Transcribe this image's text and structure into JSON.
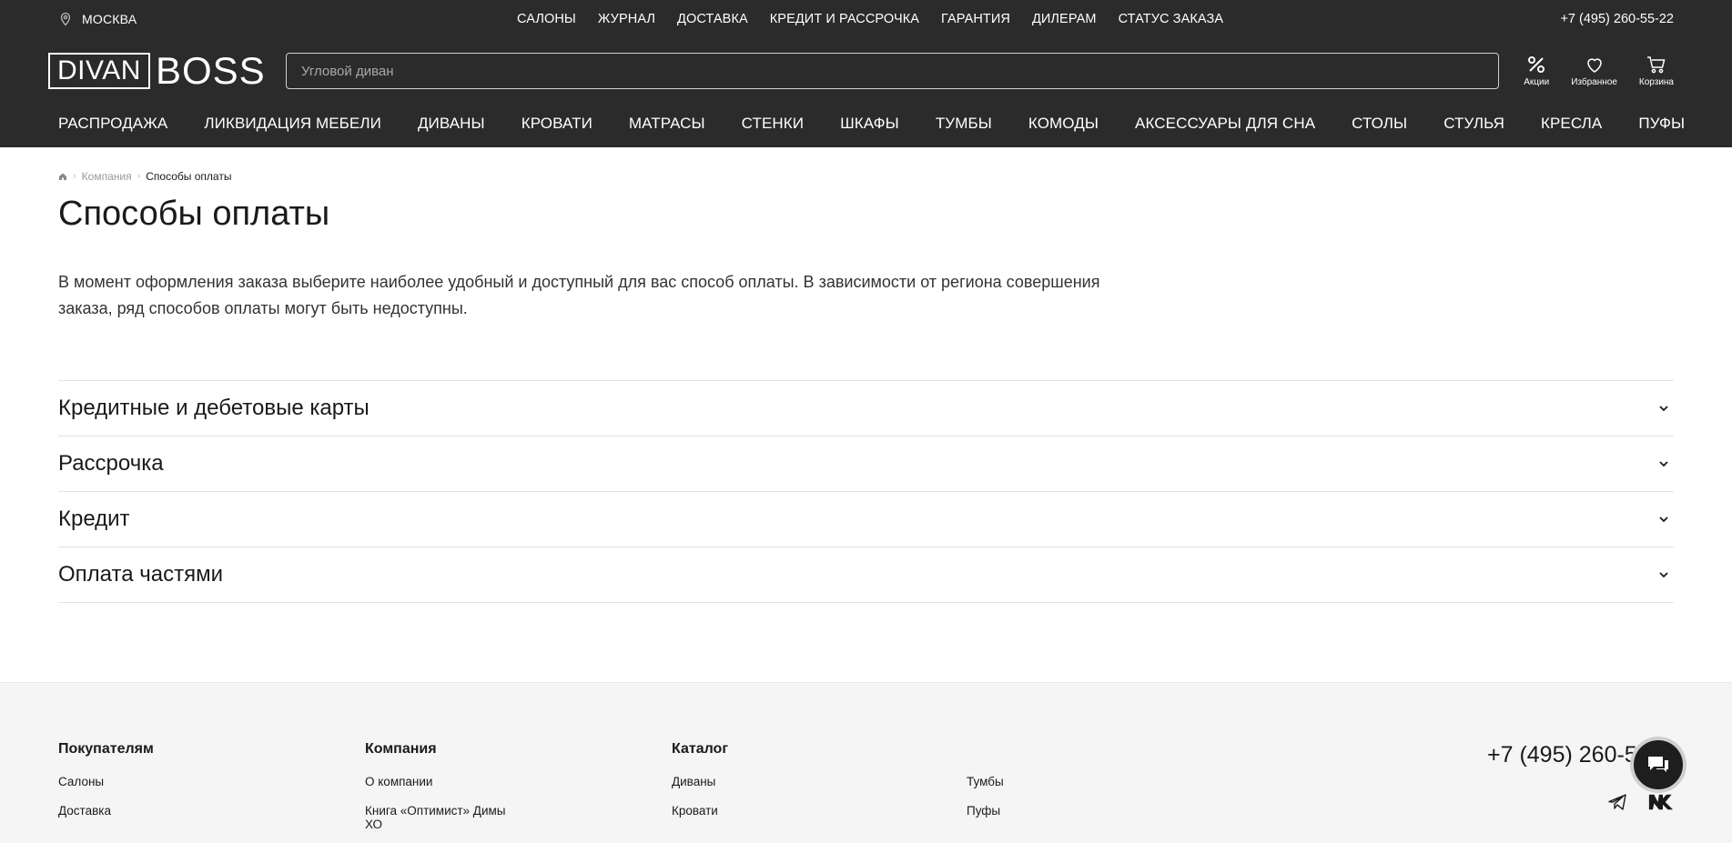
{
  "header": {
    "city": "МОСКВА",
    "top_nav": [
      "САЛОНЫ",
      "ЖУРНАЛ",
      "ДОСТАВКА",
      "КРЕДИТ И РАССРОЧКА",
      "ГАРАНТИЯ",
      "ДИЛЕРАМ",
      "СТАТУС ЗАКАЗА"
    ],
    "phone": "+7 (495) 260-55-22",
    "logo_box": "DIVAN",
    "logo_text": "BOSS",
    "search_placeholder": "Угловой диван",
    "icons": {
      "sales": "Акции",
      "favorites": "Избранное",
      "cart": "Корзина"
    },
    "categories": [
      "РАСПРОДАЖА",
      "ЛИКВИДАЦИЯ МЕБЕЛИ",
      "ДИВАНЫ",
      "КРОВАТИ",
      "МАТРАСЫ",
      "СТЕНКИ",
      "ШКАФЫ",
      "ТУМБЫ",
      "КОМОДЫ",
      "АКСЕССУАРЫ ДЛЯ СНА",
      "СТОЛЫ",
      "СТУЛЬЯ",
      "КРЕСЛА",
      "ПУФЫ"
    ]
  },
  "breadcrumb": {
    "parent": "Компания",
    "current": "Способы оплаты"
  },
  "page": {
    "title": "Способы оплаты",
    "intro": "В момент оформления заказа выберите наиболее удобный и доступный для вас способ оплаты. В зависимости от региона совершения заказа, ряд способов оплаты могут быть недоступны."
  },
  "accordion": [
    {
      "title": "Кредитные и дебетовые карты"
    },
    {
      "title": "Рассрочка"
    },
    {
      "title": "Кредит"
    },
    {
      "title": "Оплата частями"
    }
  ],
  "footer": {
    "buyers": {
      "heading": "Покупателям",
      "links": [
        "Салоны",
        "Доставка"
      ]
    },
    "company": {
      "heading": "Компания",
      "links": [
        "О компании",
        "Книга «Оптимист» Димы ХО"
      ]
    },
    "catalog": {
      "heading": "Каталог",
      "links": [
        "Диваны",
        "Кровати"
      ],
      "links2": [
        "Тумбы",
        "Пуфы"
      ]
    },
    "phone": "+7 (495) 260-55-22"
  },
  "colors": {
    "header_bg": "#2b2b2b",
    "footer_bg": "#f5f5f5",
    "text": "#1a1a1a"
  }
}
